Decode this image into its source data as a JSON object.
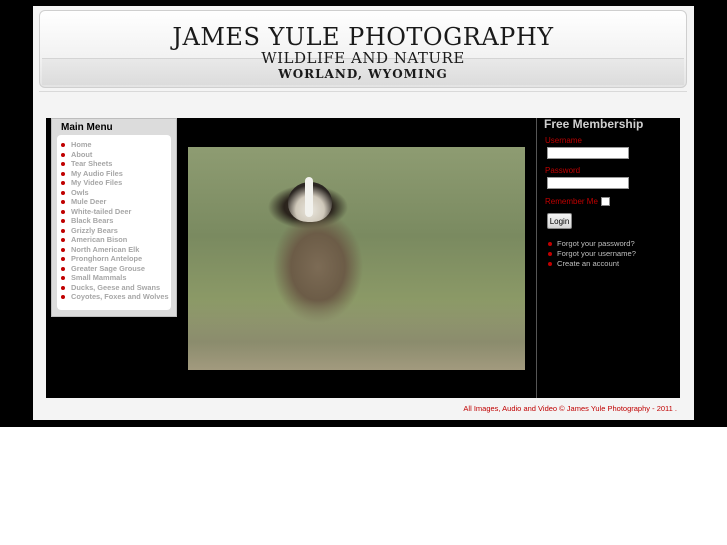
{
  "header": {
    "title": "JAMES YULE PHOTOGRAPHY",
    "subtitle": "WILDLIFE AND NATURE",
    "location": "WORLAND, WYOMING"
  },
  "main_menu": {
    "title": "Main Menu",
    "items": [
      "Home",
      "About",
      "Tear Sheets",
      "My Audio Files",
      "My Video Files",
      "Owls",
      "Mule Deer",
      "White-tailed Deer",
      "Black Bears",
      "Grizzly Bears",
      "American Bison",
      "North American Elk",
      "Pronghorn Antelope",
      "Greater Sage Grouse",
      "Small Mammals",
      "Ducks, Geese and Swans",
      "Coyotes, Foxes and Wolves"
    ]
  },
  "membership": {
    "title": "Free Membership",
    "username_label": "Username",
    "username_value": "",
    "password_label": "Password",
    "password_value": "",
    "remember_label": "Remember Me",
    "login_label": "Login",
    "links": [
      "Forgot your password?",
      "Forgot your username?",
      "Create an account"
    ]
  },
  "footer": {
    "text": "All Images, Audio and Video © James Yule Photography - 2011 ."
  },
  "colors": {
    "accent": "#c00000",
    "menu_text": "#a7a7a7",
    "background": "#000000"
  }
}
